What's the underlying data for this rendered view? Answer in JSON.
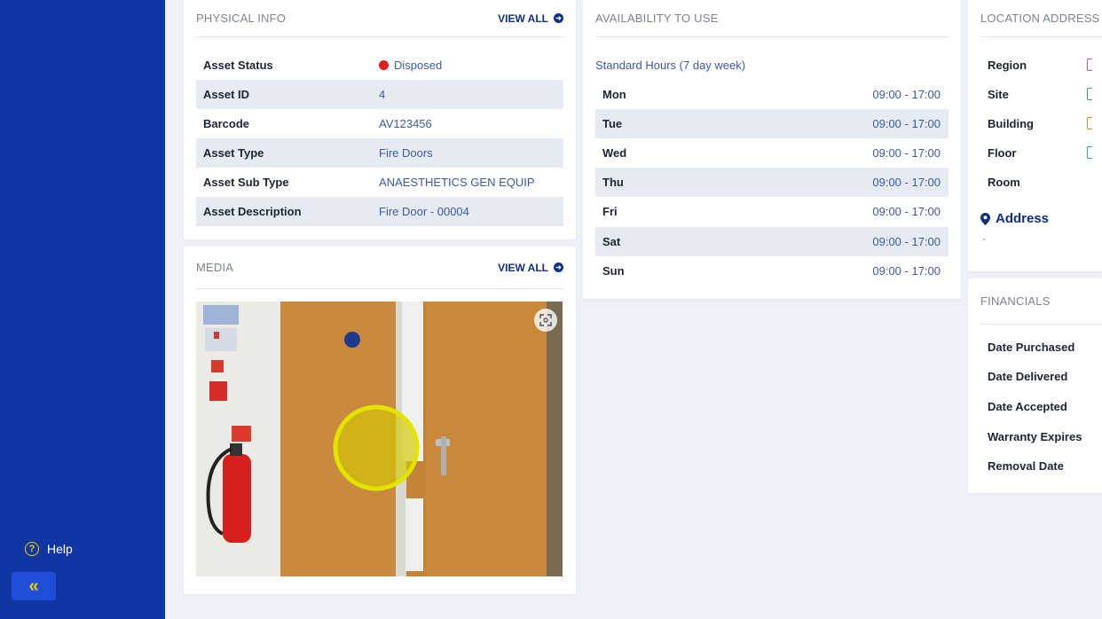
{
  "sidebar": {
    "help_label": "Help",
    "help_icon": "question-circle-icon",
    "collapse_icon": "double-chevron-left-icon",
    "collapse_glyph": "«"
  },
  "physical_info": {
    "title": "PHYSICAL INFO",
    "view_all": "VIEW ALL",
    "rows": [
      {
        "label": "Asset Status",
        "value": "Disposed",
        "status_color": "#e0201b"
      },
      {
        "label": "Asset ID",
        "value": "4"
      },
      {
        "label": "Barcode",
        "value": "AV123456"
      },
      {
        "label": "Asset Type",
        "value": "Fire Doors"
      },
      {
        "label": "Asset Sub Type",
        "value": "ANAESTHETICS GEN EQUIP"
      },
      {
        "label": "Asset Description",
        "value": "Fire Door - 00004"
      }
    ]
  },
  "media": {
    "title": "MEDIA",
    "view_all": "VIEW ALL",
    "fullscreen_icon": "expand-icon"
  },
  "availability": {
    "title": "AVAILABILITY TO USE",
    "schedule_label": "Standard Hours (7 day week)",
    "days": [
      {
        "day": "Mon",
        "hours": "09:00 - 17:00"
      },
      {
        "day": "Tue",
        "hours": "09:00 - 17:00"
      },
      {
        "day": "Wed",
        "hours": "09:00 - 17:00"
      },
      {
        "day": "Thu",
        "hours": "09:00 - 17:00"
      },
      {
        "day": "Fri",
        "hours": "09:00 - 17:00"
      },
      {
        "day": "Sat",
        "hours": "09:00 - 17:00"
      },
      {
        "day": "Sun",
        "hours": "09:00 - 17:00"
      }
    ]
  },
  "location": {
    "title": "LOCATION ADDRESS",
    "rows": [
      {
        "label": "Region",
        "swatch": "#b54fd4"
      },
      {
        "label": "Site",
        "swatch": "#27b05a"
      },
      {
        "label": "Building",
        "swatch": "#e08a2d"
      },
      {
        "label": "Floor",
        "swatch": "#2a9fd8"
      },
      {
        "label": "Room",
        "swatch": ""
      }
    ],
    "address_label": "Address",
    "address_value": "-"
  },
  "financials": {
    "title": "FINANCIALS",
    "rows": [
      "Date Purchased",
      "Date Delivered",
      "Date Accepted",
      "Warranty Expires",
      "Removal Date"
    ]
  },
  "colors": {
    "sidebar": "#0f36a3",
    "accent_yellow": "#f3d400",
    "link_blue": "#0f2f86",
    "value_blue": "#3b5aa0",
    "row_shade": "#e6eaf2",
    "page_bg": "#eef1f7"
  }
}
